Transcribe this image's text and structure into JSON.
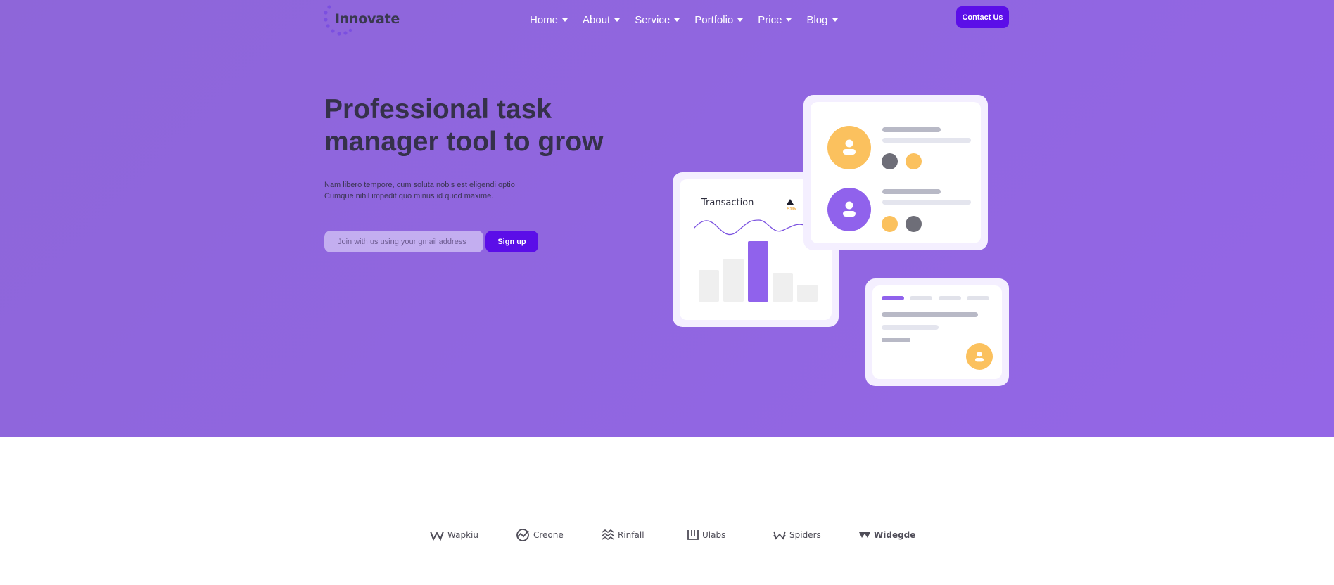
{
  "header": {
    "logo_text": "Innovate",
    "nav": [
      "Home",
      "About",
      "Service",
      "Portfolio",
      "Price",
      "Blog"
    ],
    "contact_label": "Contact Us"
  },
  "hero": {
    "headline": "Professional task manager tool to grow",
    "subtext_line1": "Nam libero tempore, cum soluta nobis est eligendi optio",
    "subtext_line2": "Cumque nihil impedit quo minus id quod maxime.",
    "email_placeholder": "Join with us using your gmail address",
    "signup_label": "Sign up"
  },
  "illustration": {
    "transaction_title": "Transaction",
    "transaction_pct": "51%"
  },
  "brands": [
    "Wapkiu",
    "Creone",
    "Rinfall",
    "Ulabs",
    "Spiders",
    "Widegde"
  ],
  "colors": {
    "hero_bg": "#9066e0",
    "primary_button": "#5b0ee8",
    "accent_orange": "#fbc15e",
    "accent_purple": "#9062ec"
  }
}
